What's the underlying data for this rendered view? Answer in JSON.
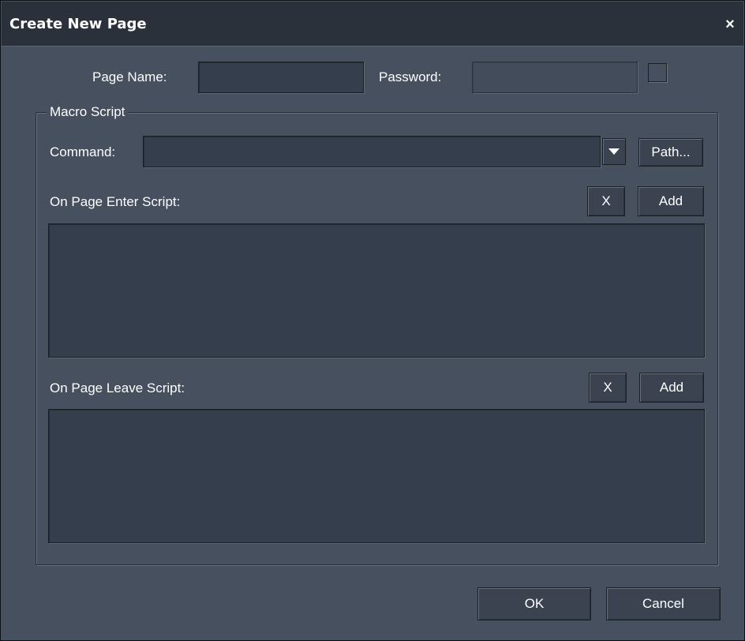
{
  "window": {
    "title": "Create New Page",
    "close_label": "×"
  },
  "page_name": {
    "label": "Page Name:",
    "value": ""
  },
  "password": {
    "label": "Password:",
    "value": "",
    "enabled": false,
    "checkbox_checked": false
  },
  "macro_script": {
    "group_label": "Macro Script",
    "command": {
      "label": "Command:",
      "value": "",
      "path_label": "Path..."
    },
    "enter_script": {
      "label": "On Page Enter Script:",
      "clear_label": "X",
      "add_label": "Add",
      "value": ""
    },
    "leave_script": {
      "label": "On Page Leave Script:",
      "clear_label": "X",
      "add_label": "Add",
      "value": ""
    }
  },
  "footer": {
    "ok_label": "OK",
    "cancel_label": "Cancel"
  }
}
